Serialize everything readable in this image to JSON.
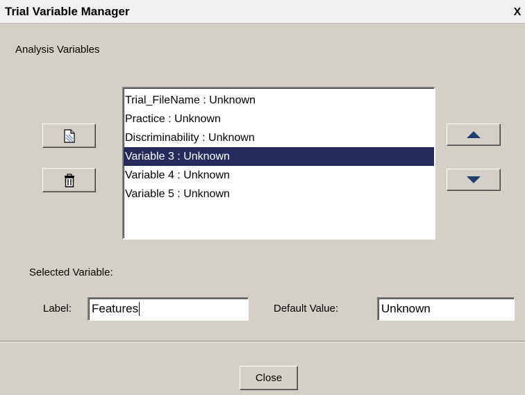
{
  "window": {
    "title": "Trial Variable Manager",
    "close_glyph": "X"
  },
  "analysis": {
    "section_label": "Analysis Variables",
    "items": [
      {
        "label": "Trial_FileName : Unknown",
        "selected": false
      },
      {
        "label": "Practice : Unknown",
        "selected": false
      },
      {
        "label": "Discriminability : Unknown",
        "selected": false
      },
      {
        "label": "Variable 3 : Unknown",
        "selected": true
      },
      {
        "label": "Variable 4 : Unknown",
        "selected": false
      },
      {
        "label": "Variable 5 : Unknown",
        "selected": false
      }
    ]
  },
  "buttons": {
    "new_icon": "new-document-icon",
    "delete_icon": "trash-icon",
    "up_icon": "arrow-up-icon",
    "down_icon": "arrow-down-icon",
    "close_label": "Close"
  },
  "selected_variable": {
    "heading": "Selected Variable:",
    "label_caption": "Label:",
    "label_value": "Features",
    "default_caption": "Default Value:",
    "default_value": "Unknown"
  },
  "colors": {
    "window_bg": "#d4d0c8",
    "selection_bg": "#262b5e",
    "arrow_color": "#1f3d6b"
  }
}
